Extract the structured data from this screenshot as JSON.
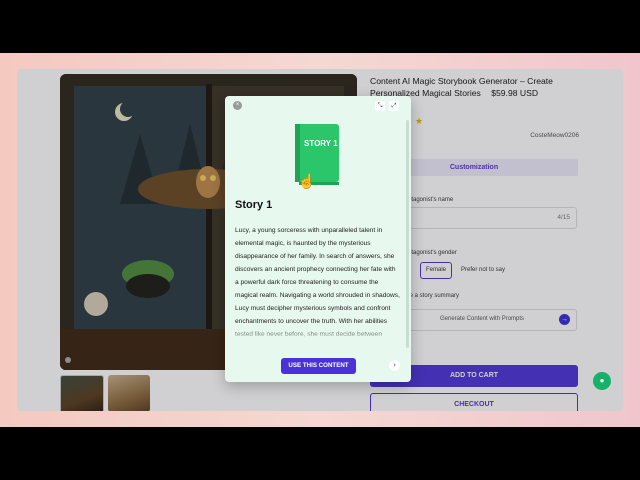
{
  "product": {
    "title": "Content AI Magic Storybook Generator – Create Personalized Magical Stories",
    "price": "$59.98 USD",
    "stars": "★",
    "vendor": "CosteMeow0206"
  },
  "customization": {
    "tab_label": "Customization",
    "name_label": "otagonist's name",
    "name_count": "4/15",
    "gender_label": "otagonist's gender",
    "gender_options": [
      "Female",
      "Prefer not to say"
    ],
    "summary_label": "te a story summary",
    "summary_field_text": "Generate Content with Prompts"
  },
  "actions": {
    "add_to_cart": "ADD TO CART",
    "checkout": "CHECKOUT"
  },
  "modal": {
    "book_label": "STORY 1",
    "title": "Story 1",
    "body": "Lucy, a young sorceress with unparalleled talent in elemental magic, is haunted by the mysterious disappearance of her family. In search of answers, she discovers an ancient prophecy connecting her fate with a powerful dark force threatening to consume the magical realm. Navigating a world shrouded in shadows, Lucy must decipher mysterious symbols and confront enchantments to uncover the truth. With her abilities tested like never before, she must decide between saving the realm or unveiling the secrets of",
    "use_button": "USE THIS CONTENT"
  },
  "colors": {
    "accent": "#4b32d8",
    "modal_bg": "#e7f8ee",
    "book": "#2bc66a",
    "chat": "#17b26a"
  },
  "icons": [
    "close-icon",
    "minimize-icon",
    "expand-icon",
    "hand-cursor-icon",
    "next-arrow-icon",
    "chat-icon",
    "arrow-right-icon"
  ]
}
